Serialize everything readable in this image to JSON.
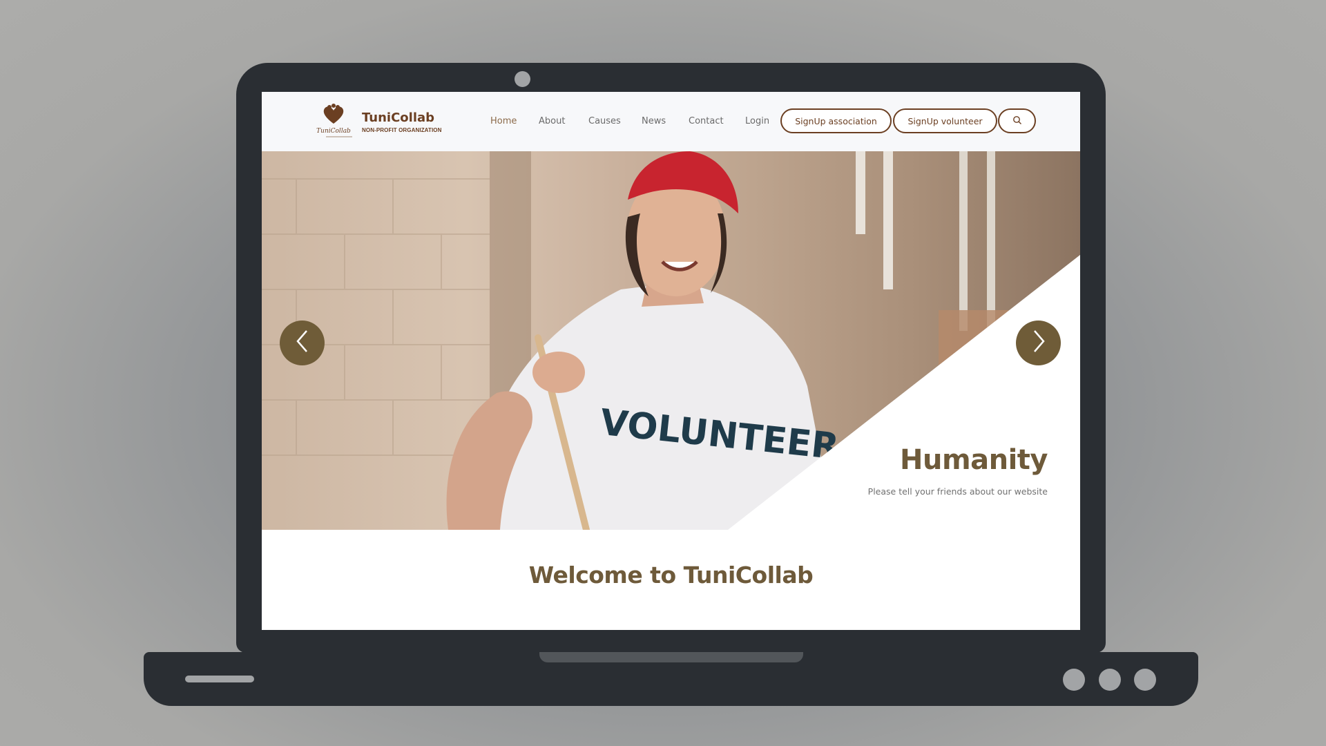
{
  "site": {
    "brand_name": "TuniCollab",
    "brand_tagline": "NON-PROFIT ORGANIZATION",
    "logo_text": "TuniCollab"
  },
  "nav": {
    "links": [
      "Home",
      "About",
      "Causes",
      "News",
      "Contact",
      "Login"
    ],
    "active": "Home",
    "signup_association": "SignUp association",
    "signup_volunteer": "SignUp volunteer",
    "search_icon": "search-icon"
  },
  "hero": {
    "title": "Humanity",
    "subtitle": "Please tell your friends about our website",
    "shirt_text": "VOLUNTEER",
    "prev_icon": "chevron-left-icon",
    "next_icon": "chevron-right-icon"
  },
  "main": {
    "welcome": "Welcome to TuniCollab"
  },
  "colors": {
    "brand_brown": "#6b3f22",
    "accent_olive": "#6f5c38",
    "heading": "#6e5a3a",
    "laptop": "#2a2e33"
  }
}
